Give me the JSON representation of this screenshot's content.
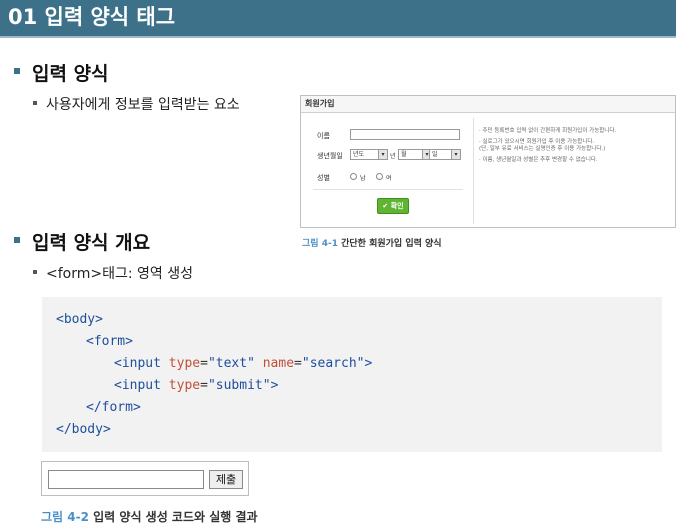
{
  "header": {
    "title": "01 입력 양식 태그"
  },
  "section1": {
    "heading": "입력 양식",
    "bullet": "사용자에게 정보를 입력받는 요소"
  },
  "figure1": {
    "form_title": "회원가입",
    "labels": {
      "name": "이름",
      "birth": "생년월일",
      "gender": "성별"
    },
    "selects": {
      "year": "년도",
      "month": "월",
      "day": "일"
    },
    "units": {
      "year": "년",
      "month": "월",
      "day": "일"
    },
    "radios": {
      "male": "남",
      "female": "여"
    },
    "submit": "확인",
    "notes": [
      "· 주민 등록번호 입력 없이 간편하게 회원가입이 가능합니다.",
      "· 실로그가 있으시면 회원가입 후 이용 가능합니다.",
      "  (단, 일부 유료 서비스는 실명인증 후 이용 가능합니다.)",
      "· 이름, 생년월일과 성별은 추후 변경할 수 없습니다."
    ],
    "caption_num": "그림 4-1",
    "caption_text": "간단한 회원가입 입력 양식"
  },
  "section2": {
    "heading": "입력 양식 개요",
    "bullet": "<form>태그: 영역 생성"
  },
  "code": {
    "line1_tag": "<body>",
    "line2_tag": "<form>",
    "line3": {
      "open": "<input",
      "attr1": "type",
      "val1": "\"text\"",
      "attr2": "name",
      "val2": "\"search\"",
      "close": ">"
    },
    "line4": {
      "open": "<input",
      "attr1": "type",
      "val1": "\"submit\"",
      "close": ">"
    },
    "line5_tag": "</form>",
    "line6_tag": "</body>"
  },
  "figure2": {
    "button": "제출",
    "caption_num": "그림 4-2",
    "caption_text": "입력 양식 생성 코드와 실행 결과"
  }
}
